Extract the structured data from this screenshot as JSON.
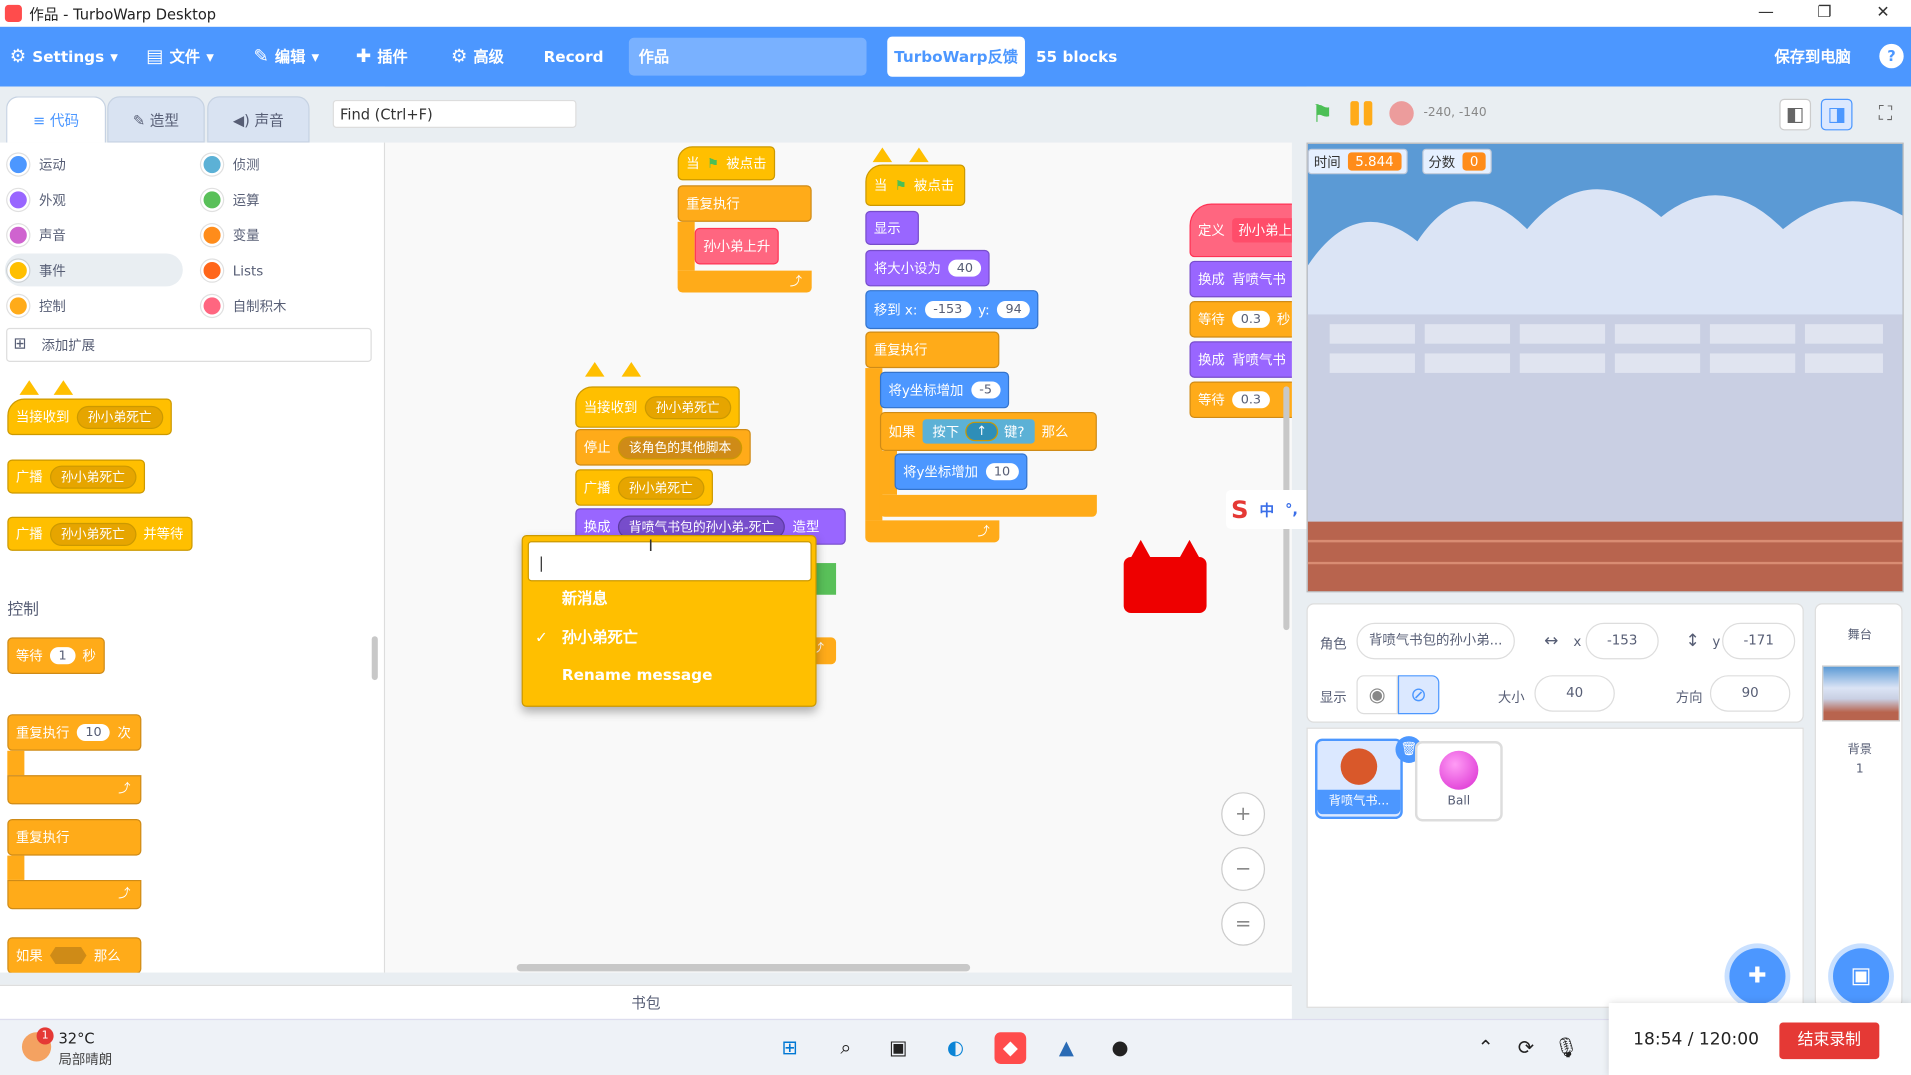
{
  "window": {
    "title": "作品 - TurboWarp Desktop",
    "min": "—",
    "restore": "❐",
    "close": "✕"
  },
  "menu": {
    "settings": "Settings",
    "file": "文件",
    "edit": "编辑",
    "addons": "插件",
    "advanced": "高级",
    "record": "Record",
    "project_title": "作品",
    "feedback": "TurboWarp反馈",
    "block_count": "55 blocks",
    "save": "保存到电脑",
    "help": "?"
  },
  "tabs": {
    "code": "代码",
    "costumes": "造型",
    "sounds": "声音"
  },
  "find": {
    "placeholder": "Find (Ctrl+F)"
  },
  "stage_controls": {
    "coords": "-240, -140"
  },
  "categories": [
    {
      "label": "运动",
      "color": "#4c97ff"
    },
    {
      "label": "外观",
      "color": "#9966ff"
    },
    {
      "label": "声音",
      "color": "#cf63cf"
    },
    {
      "label": "事件",
      "color": "#ffbf00"
    },
    {
      "label": "控制",
      "color": "#ffab19"
    },
    {
      "label": "侦测",
      "color": "#5cb1d6"
    },
    {
      "label": "运算",
      "color": "#59c059"
    },
    {
      "label": "变量",
      "color": "#ff8c1a"
    },
    {
      "label": "Lists",
      "color": "#ff661a"
    },
    {
      "label": "自制积木",
      "color": "#ff6680"
    }
  ],
  "add_extension": "添加扩展",
  "palette": {
    "when_receive": "当接收到",
    "when_receive_msg": "孙小弟死亡",
    "broadcast": "广播",
    "broadcast_msg": "孙小弟死亡",
    "broadcast_wait": "广播",
    "broadcast_wait_msg": "孙小弟死亡",
    "broadcast_wait_suffix": "并等待",
    "section_control": "控制",
    "wait": "等待",
    "wait_val": "1",
    "wait_unit": "秒",
    "repeat": "重复执行",
    "repeat_val": "10",
    "repeat_unit": "次",
    "forever": "重复执行",
    "if": "如果",
    "then": "那么"
  },
  "scripts": {
    "s1_hat": "当",
    "s1_hat2": "被点击",
    "s1_forever": "重复执行",
    "s1_inner": "孙小弟上升",
    "s2_hat": "当",
    "s2_hat2": "被点击",
    "s2_show": "显示",
    "s2_size": "将大小设为",
    "s2_size_val": "40",
    "s2_goto": "移到 x:",
    "s2_goto_x": "-153",
    "s2_goto_y_label": "y:",
    "s2_goto_y": "94",
    "s2_forever": "重复执行",
    "s2_changey": "将y坐标增加",
    "s2_changey_val": "-5",
    "s2_if": "如果",
    "s2_key": "按下",
    "s2_key_val": "↑",
    "s2_key_suffix": "键?",
    "s2_then": "那么",
    "s2_changey2": "将y坐标增加",
    "s2_changey2_val": "10",
    "s3_hat": "当接收到",
    "s3_hat_msg": "孙小弟死亡",
    "s3_stop": "停止",
    "s3_stop_opt": "该角色的其他脚本",
    "s3_bcast": "广播",
    "s3_bcast_msg": "孙小弟死亡",
    "s3_switch": "换成",
    "s3_switch_opt": "背喷气书包的孙小弟-死亡",
    "s3_switch_suffix": "造型",
    "s4_define": "定义",
    "s4_define_name": "孙小弟上升",
    "s4_switch": "换成",
    "s4_switch_opt": "背喷气书",
    "s4_wait": "等待",
    "s4_wait_val": "0.3",
    "s4_wait_unit": "秒",
    "s4_switch2": "换成",
    "s4_switch2_opt": "背喷气书",
    "s4_wait2": "等待",
    "s4_wait2_val": "0.3"
  },
  "dropdown": {
    "input_value": "|",
    "new_message": "新消息",
    "checked_item": "孙小弟死亡",
    "check": "✓",
    "rename": "Rename message"
  },
  "zoom": {
    "in": "+",
    "out": "−",
    "reset": "="
  },
  "backpack": "书包",
  "stage": {
    "timer_label": "时间",
    "timer_value": "5.844",
    "score_label": "分数",
    "score_value": "0"
  },
  "sprite_info": {
    "sprite_label": "角色",
    "sprite_name": "背喷气书包的孙小弟...",
    "x_label": "x",
    "x": "-153",
    "y_label": "y",
    "y": "-171",
    "show_label": "显示",
    "size_label": "大小",
    "size": "40",
    "dir_label": "方向",
    "dir": "90"
  },
  "sprites": [
    {
      "name": "背喷气书..."
    },
    {
      "name": "Ball"
    }
  ],
  "stage_pane": {
    "title": "舞台",
    "backdrop_label": "背景",
    "backdrop_count": "1"
  },
  "ime": {
    "lang": "中",
    "punct": "°,"
  },
  "taskbar": {
    "temp": "32°C",
    "weather": "局部晴朗",
    "badge": "1"
  },
  "recording": {
    "time": "18:54 / 120:00",
    "stop": "结束录制"
  },
  "colors": {
    "accent": "#4c97ff",
    "events": "#ffbf00",
    "control": "#ffab19",
    "looks": "#9966ff",
    "motion": "#4c97ff",
    "custom": "#ff6680",
    "stop_red": "#e53935"
  }
}
